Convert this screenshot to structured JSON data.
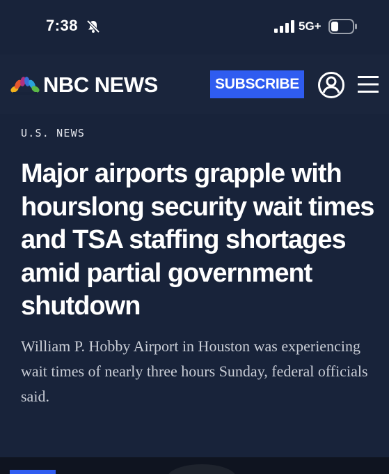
{
  "status_bar": {
    "time": "7:38",
    "network": "5G+",
    "icons": [
      "mute-bell-icon",
      "signal-bars-icon",
      "battery-icon"
    ]
  },
  "header": {
    "brand": "NBC NEWS",
    "logo_icon": "peacock-icon",
    "subscribe_label": "SUBSCRIBE",
    "account_icon": "account-icon",
    "menu_icon": "hamburger-menu-icon"
  },
  "article": {
    "section": "U.S. NEWS",
    "headline": "Major airports grapple with hourslong security wait times and TSA staffing shortages amid partial government shutdown",
    "dek": "William P. Hobby Airport in Houston was experiencing wait times of nearly three hours Sunday, federal officials said."
  },
  "colors": {
    "background": "#18233a",
    "accent": "#2f5cf0"
  }
}
